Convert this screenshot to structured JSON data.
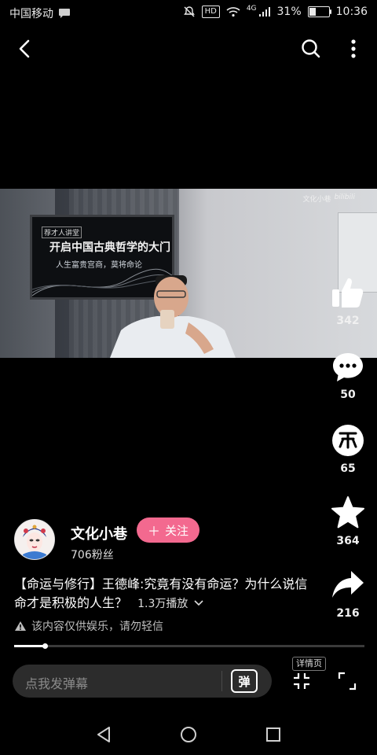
{
  "status_bar": {
    "carrier": "中国移动",
    "hd_label": "HD",
    "network": "4G",
    "battery": "31%",
    "time": "10:36"
  },
  "video": {
    "slide_badge": "荐才人讲堂",
    "slide_title": "开启中国古典哲学的大门",
    "slide_subtitle": "人生富贵宫商，莫将命论",
    "watermark_channel": "文化小巷",
    "watermark_brand": "bilibili"
  },
  "actions": [
    {
      "name": "like",
      "icon": "thumbs-up-icon",
      "count": "342"
    },
    {
      "name": "comment",
      "icon": "comment-bubble-icon",
      "count": "50"
    },
    {
      "name": "coin",
      "icon": "coin-icon",
      "count": "65"
    },
    {
      "name": "favorite",
      "icon": "star-icon",
      "count": "364"
    },
    {
      "name": "share",
      "icon": "share-arrow-icon",
      "count": "216"
    }
  ],
  "author": {
    "name": "文化小巷",
    "fans": "706粉丝",
    "follow_label": "关注",
    "follow_symbol": "＋"
  },
  "post": {
    "title": "【命运与修行】王德峰:究竟有没有命运？为什么说信命才是积极的人生？",
    "plays": "1.3万播放",
    "disclaimer": "该内容仅供娱乐，请勿轻信"
  },
  "progress": {
    "fraction": 0.09
  },
  "bottom": {
    "danmu_placeholder": "点我发弹幕",
    "danmu_button": "弹",
    "detail_label": "详情页"
  },
  "colors": {
    "accent_pink": "#f3698f",
    "background": "#000000"
  }
}
